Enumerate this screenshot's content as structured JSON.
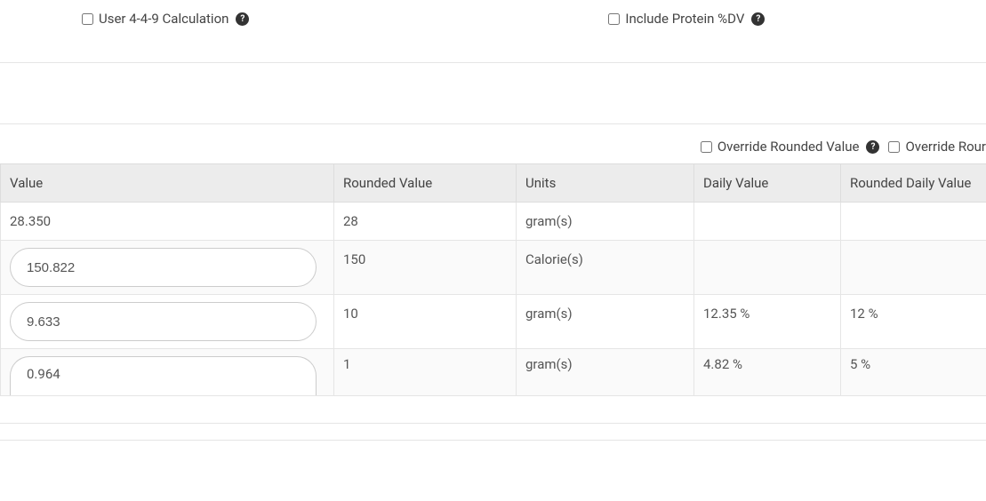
{
  "options": {
    "calc449_label": "User 4-4-9 Calculation",
    "include_protein_label": "Include Protein %DV"
  },
  "overrides": {
    "override_rounded_label": "Override Rounded Value",
    "override_rounded_dv_label": "Override Rour"
  },
  "table": {
    "headers": {
      "value": "Value",
      "rounded": "Rounded Value",
      "units": "Units",
      "daily": "Daily Value",
      "rounded_daily": "Rounded Daily Value"
    },
    "rows": [
      {
        "value": "28.350",
        "editable": false,
        "rounded": "28",
        "units": "gram(s)",
        "daily": "",
        "rounded_daily": ""
      },
      {
        "value": "150.822",
        "editable": true,
        "rounded": "150",
        "units": "Calorie(s)",
        "daily": "",
        "rounded_daily": ""
      },
      {
        "value": "9.633",
        "editable": true,
        "rounded": "10",
        "units": "gram(s)",
        "daily": "12.35 %",
        "rounded_daily": "12 %"
      },
      {
        "value": "0.964",
        "editable": true,
        "rounded": "1",
        "units": "gram(s)",
        "daily": "4.82 %",
        "rounded_daily": "5 %"
      }
    ]
  }
}
